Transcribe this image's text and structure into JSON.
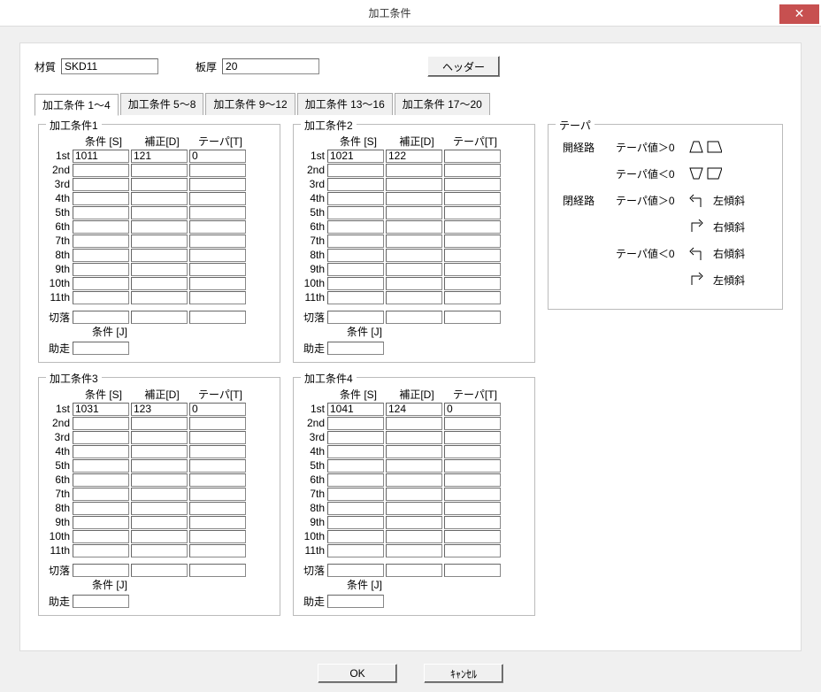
{
  "title": "加工条件",
  "top": {
    "material_label": "材質",
    "material_value": "SKD11",
    "thickness_label": "板厚",
    "thickness_value": "20",
    "header_btn": "ヘッダー"
  },
  "tabs": [
    "加工条件 1～4",
    "加工条件 5～8",
    "加工条件 9～12",
    "加工条件 13～16",
    "加工条件 17～20"
  ],
  "row_labels": [
    "1st",
    "2nd",
    "3rd",
    "4th",
    "5th",
    "6th",
    "7th",
    "8th",
    "9th",
    "10th",
    "11th"
  ],
  "col_headers": {
    "s": "条件 [S]",
    "d": "補正[D]",
    "t": "テーパ[T]"
  },
  "extra": {
    "cutoff": "切落",
    "jcond": "条件 [J]",
    "approach": "助走"
  },
  "blocks": [
    {
      "title": "加工条件1",
      "data": {
        "1st": {
          "s": "1011",
          "d": "121",
          "t": "0"
        }
      }
    },
    {
      "title": "加工条件2",
      "data": {
        "1st": {
          "s": "1021",
          "d": "122",
          "t": ""
        }
      }
    },
    {
      "title": "加工条件3",
      "data": {
        "1st": {
          "s": "1031",
          "d": "123",
          "t": "0"
        }
      }
    },
    {
      "title": "加工条件4",
      "data": {
        "1st": {
          "s": "1041",
          "d": "124",
          "t": "0"
        }
      }
    }
  ],
  "taper": {
    "title": "テーパ",
    "rows": [
      {
        "l": "開経路",
        "s": "テーパ値＞0",
        "note": ""
      },
      {
        "l": "",
        "s": "テーパ値＜0",
        "note": ""
      },
      {
        "l": "閉経路",
        "s": "テーパ値＞0",
        "note": "左傾斜"
      },
      {
        "l": "",
        "s": "",
        "note": "右傾斜"
      },
      {
        "l": "",
        "s": "テーパ値＜0",
        "note": "右傾斜"
      },
      {
        "l": "",
        "s": "",
        "note": "左傾斜"
      }
    ]
  },
  "buttons": {
    "ok": "OK",
    "cancel": "ｷｬﾝｾﾙ"
  }
}
